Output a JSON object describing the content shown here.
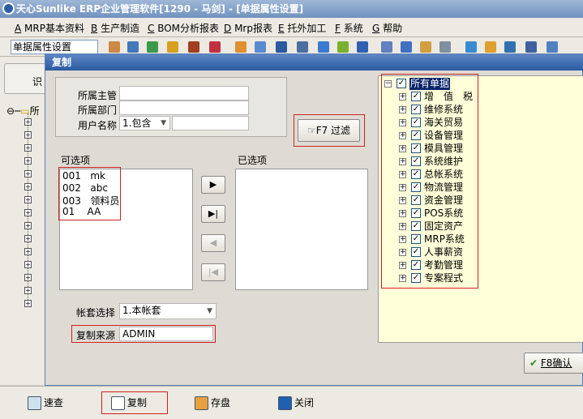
{
  "window": {
    "title": "天心Sunlike ERP企业管理软件[1290 - 马剑] - [单据属性设置]"
  },
  "menu": [
    {
      "key": "A",
      "label": "MRP基本资料"
    },
    {
      "key": "B",
      "label": "生产制造"
    },
    {
      "key": "C",
      "label": "BOM分析报表"
    },
    {
      "key": "D",
      "label": "Mrp报表"
    },
    {
      "key": "E",
      "label": "托外加工"
    },
    {
      "key": "F",
      "label": "系统"
    },
    {
      "key": "G",
      "label": "帮助"
    }
  ],
  "toolbar": {
    "combo_value": "单据属性设置"
  },
  "background": {
    "tab_label": "识",
    "tree_root": "所"
  },
  "dialog": {
    "title": "复制",
    "supervisor_label": "所属主管",
    "department_label": "所属部门",
    "username_label": "用户名称",
    "username_op": "1.包含",
    "filter_button": "F7 过滤",
    "available_label": "可选项",
    "selected_label": "已选项",
    "available_items": [
      {
        "code": "001",
        "name": "mk"
      },
      {
        "code": "002",
        "name": "abc"
      },
      {
        "code": "003",
        "name": "领料员"
      },
      {
        "code": "01",
        "name": "AA"
      }
    ],
    "account_label": "帐套选择",
    "account_value": "1.本帐套",
    "source_label": "复制来源",
    "source_value": "ADMIN",
    "confirm_button": "F8确认",
    "tree": {
      "root": "所有单据",
      "items": [
        "增　值　税",
        "维修系统",
        "海关贸易",
        "设备管理",
        "模具管理",
        "系统维护",
        "总帐系统",
        "物流管理",
        "资金管理",
        "POS系统",
        "固定资产",
        "MRP系统",
        "人事薪资",
        "考勤管理",
        "专案程式"
      ]
    }
  },
  "bottom": {
    "query": "速查",
    "copy": "复制",
    "save": "存盘",
    "close": "关闭"
  }
}
